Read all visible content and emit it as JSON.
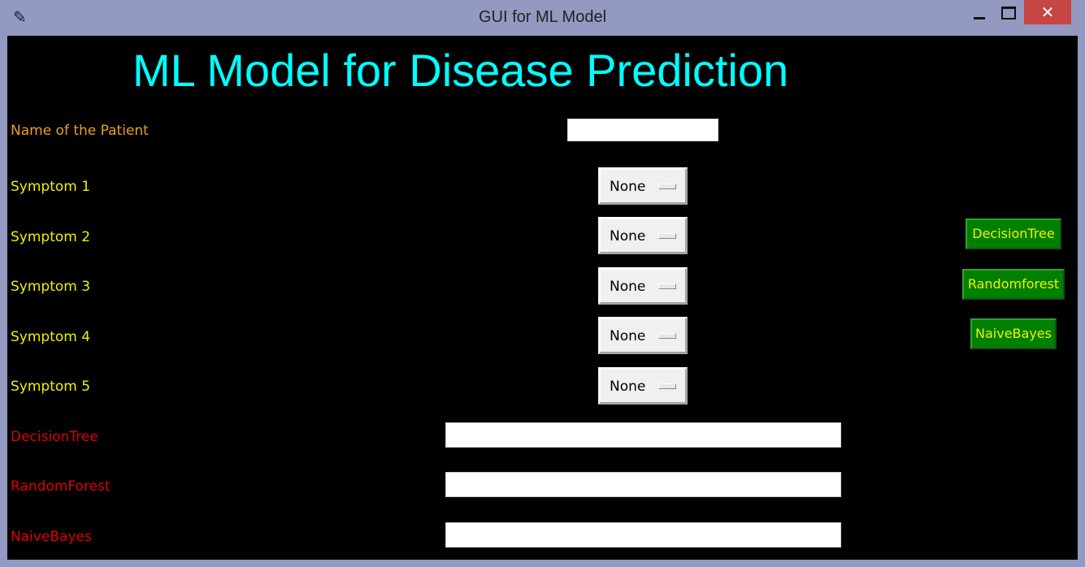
{
  "window": {
    "title": "GUI for ML Model",
    "icon": "feather-icon",
    "close_glyph": "✕",
    "app_glyph": "✎"
  },
  "heading": "ML Model for Disease Prediction",
  "patient": {
    "label": "Name of the Patient",
    "value": ""
  },
  "symptoms": [
    {
      "label": "Symptom 1",
      "selected": "None"
    },
    {
      "label": "Symptom 2",
      "selected": "None"
    },
    {
      "label": "Symptom 3",
      "selected": "None"
    },
    {
      "label": "Symptom 4",
      "selected": "None"
    },
    {
      "label": "Symptom 5",
      "selected": "None"
    }
  ],
  "buttons": {
    "decision_tree": "DecisionTree",
    "random_forest": "Randomforest",
    "naive_bayes": "NaiveBayes"
  },
  "results": [
    {
      "label": "DecisionTree",
      "value": ""
    },
    {
      "label": "RandomForest",
      "value": ""
    },
    {
      "label": "NaiveBayes",
      "value": ""
    }
  ],
  "colors": {
    "background": "#000000",
    "heading": "#00ffff",
    "patient_label": "#e8a020",
    "symptom_label": "#f0f000",
    "result_label": "#e00000",
    "button_bg": "#008000",
    "button_text": "#f0f000",
    "titlebar": "#9399c0",
    "close_button": "#c74545"
  }
}
